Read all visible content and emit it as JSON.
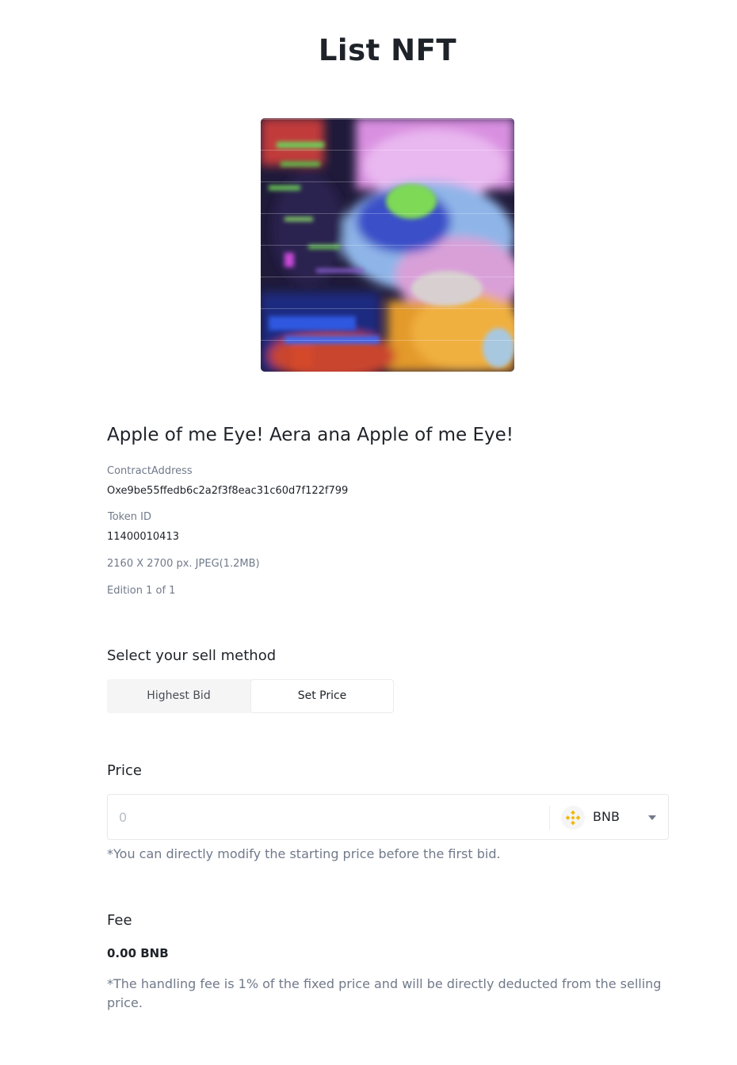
{
  "page": {
    "title": "List NFT"
  },
  "nft": {
    "name": "Apple of me Eye! Aera ana Apple of me Eye!",
    "contract_label": "ContractAddress",
    "contract_value": "Oxe9be55ffedb6c2a2f3f8eac31c60d7f122f799",
    "token_label": "Token ID",
    "token_value": "11400010413",
    "file_info": "2160 X 2700 px. JPEG(1.2MB)",
    "edition": "Edition 1 of 1"
  },
  "sell_method": {
    "title": "Select your sell method",
    "options": [
      "Highest Bid",
      "Set Price"
    ],
    "selected": "Set Price"
  },
  "price": {
    "title": "Price",
    "placeholder": "0",
    "currency": "BNB",
    "hint": "*You can directly modify the starting price before the first bid."
  },
  "fee": {
    "title": "Fee",
    "value": "0.00 BNB",
    "hint": "*The handling fee is 1% of the fixed price and will be directly deducted from the selling price."
  },
  "colors": {
    "accent": "#f0b90b",
    "text_primary": "#1e2329",
    "text_secondary": "#707a8a"
  },
  "icons": {
    "currency_icon": "bnb-icon",
    "dropdown_icon": "chevron-down-icon"
  }
}
